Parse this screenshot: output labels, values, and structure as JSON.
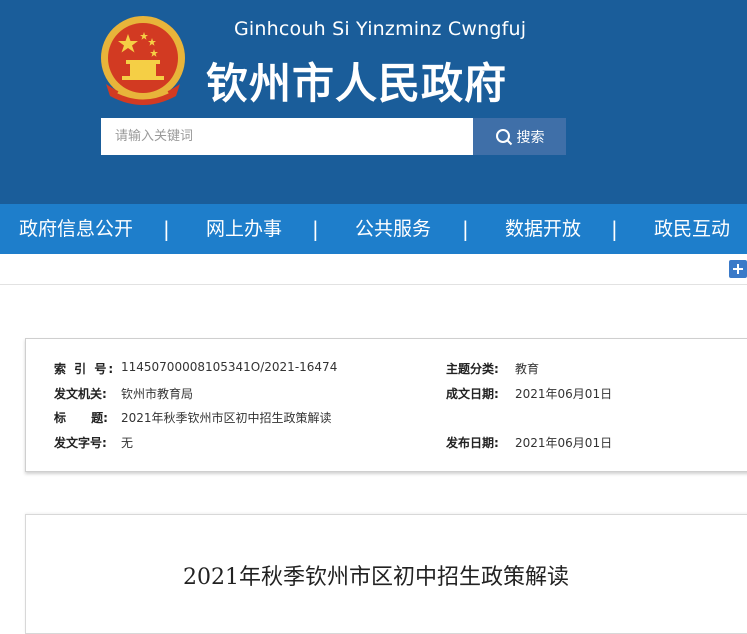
{
  "header": {
    "subtitle": "Ginhcouh Si Yinzminz Cwngfuj",
    "title": "钦州市人民政府",
    "colors": {
      "background": "#1a5d9a",
      "nav": "#1e7ecb",
      "search_button": "#3f6fa8"
    }
  },
  "search": {
    "placeholder": "请输入关键词",
    "button_label": "搜索"
  },
  "nav": {
    "items": [
      "政府信息公开",
      "网上办事",
      "公共服务",
      "数据开放",
      "政民互动"
    ],
    "separator": "|"
  },
  "meta": {
    "index_label": "索  引  号:",
    "index_value": "11450700008105341O/2021-16474",
    "topic_label": "主题分类:",
    "topic_value": "教育",
    "issuer_label": "发文机关:",
    "issuer_value": "钦州市教育局",
    "created_label": "成文日期:",
    "created_value": "2021年06月01日",
    "title_label": "标      题:",
    "title_value": "2021年秋季钦州市区初中招生政策解读",
    "docno_label": "发文字号:",
    "docno_value": "无",
    "published_label": "发布日期:",
    "published_value": "2021年06月01日"
  },
  "article": {
    "title": "2021年秋季钦州市区初中招生政策解读"
  }
}
